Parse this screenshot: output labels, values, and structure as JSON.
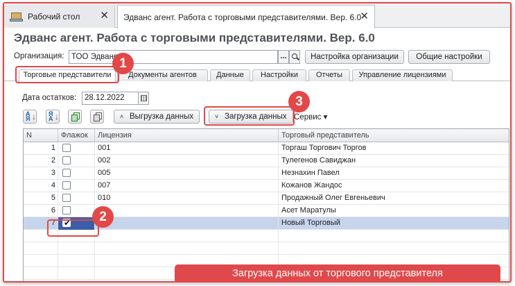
{
  "window_tabs": [
    {
      "label": "Рабочий стол",
      "close": "✕"
    },
    {
      "label": "Эдванс агент. Работа с торговыми представителями. Вер. 6.0",
      "close": "✕"
    }
  ],
  "title": "Эдванс агент. Работа с торговыми представителями. Вер. 6.0",
  "organization": {
    "label": "Организация:",
    "value": "ТОО Эдванс",
    "select_button": "...",
    "settings_button": "Настройка организации",
    "general_settings_button": "Общие настройки"
  },
  "section_tabs": [
    "Торговые представители",
    "Документы агентов",
    "Данные",
    "Настройки",
    "Отчеты",
    "Управление лицензиями"
  ],
  "date": {
    "label": "Дата остатков:",
    "value": "28.12.2022"
  },
  "toolbar": {
    "upload_label": "Выгрузка данных",
    "download_label": "Загрузка данных",
    "service_label": "Сервис ▾",
    "chevron_up": "˄",
    "chevron_down": "˅",
    "sort_text": "А\nЯ"
  },
  "table": {
    "columns": [
      "N",
      "Флажок",
      "Лицензия",
      "Торговый представитель"
    ],
    "rows": [
      {
        "n": "1",
        "flag": false,
        "license": "001",
        "rep": "Торгаш Торгович Торгов"
      },
      {
        "n": "2",
        "flag": false,
        "license": "002",
        "rep": "Тулегенов Савиджан"
      },
      {
        "n": "3",
        "flag": false,
        "license": "005",
        "rep": "Незнахин Павел"
      },
      {
        "n": "4",
        "flag": false,
        "license": "007",
        "rep": "Кожанов Жандос"
      },
      {
        "n": "5",
        "flag": false,
        "license": "010",
        "rep": "Продажный Олег Евгеньевич"
      },
      {
        "n": "6",
        "flag": false,
        "license": "",
        "rep": "Асет Маратулы"
      },
      {
        "n": "7",
        "flag": true,
        "license": "",
        "rep": "Новый Торговый",
        "selected": true
      }
    ],
    "check_mark": "✔"
  },
  "annotations": {
    "badges": [
      "1",
      "2",
      "3"
    ],
    "caption": "Загрузка данных от торгового представителя",
    "color": "#e24848"
  },
  "colors": {
    "title": "#4e5157",
    "selection_row": "#c6d4ec",
    "selection_cell": "#3b5ea8"
  }
}
